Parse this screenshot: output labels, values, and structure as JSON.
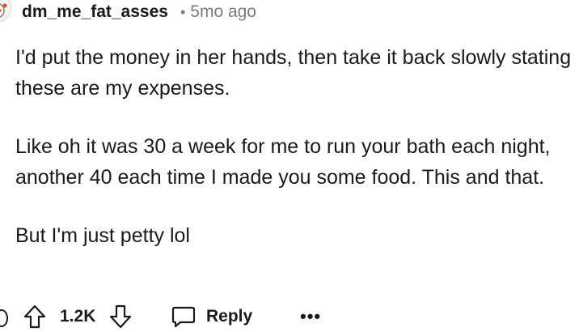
{
  "comment": {
    "username": "dm_me_fat_asses",
    "separator": "•",
    "timestamp": "5mo ago",
    "paragraphs": [
      "I'd put the money in her hands, then take it back slowly stating these are my expenses.",
      "Like oh it was 30 a week for me to run your bath each night, another 40 each time I made you some food. This and that.",
      "But I'm just petty lol"
    ]
  },
  "actions": {
    "score": "1.2K",
    "reply_label": "Reply",
    "more_label": "•••"
  },
  "icons": {
    "avatar": "snoo-avatar-icon",
    "upvote": "upvote-arrow-icon",
    "downvote": "downvote-arrow-icon",
    "reply": "speech-bubble-icon",
    "more": "more-options-icon"
  }
}
